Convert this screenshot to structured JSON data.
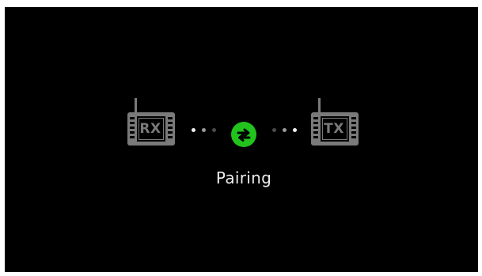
{
  "screen": {
    "background": "#000000",
    "status_text": "Pairing"
  },
  "receiver": {
    "label": "RX",
    "icon": "radio-receiver-icon"
  },
  "transmitter": {
    "label": "TX",
    "icon": "radio-transmitter-icon"
  },
  "pair_icon": {
    "icon": "sync-arrows-icon",
    "color": "#22c31d"
  },
  "colors": {
    "device_gray": "#7a7a7a",
    "dot_bright": "#f2f2f2",
    "dot_mid": "#9a9a9a",
    "dot_dim": "#4a4a4a"
  }
}
